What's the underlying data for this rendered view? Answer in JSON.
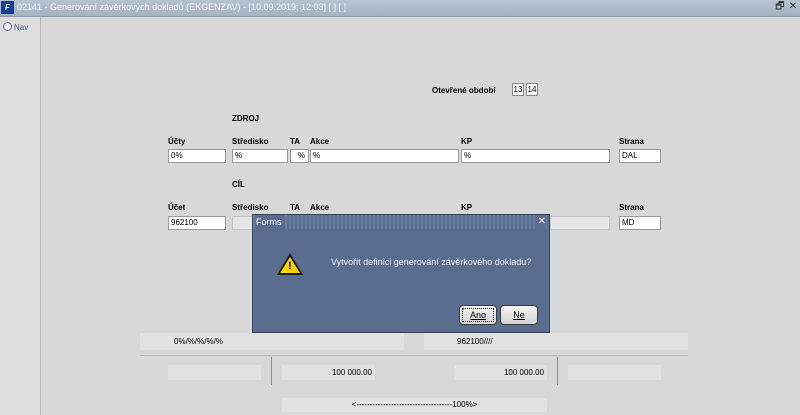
{
  "window": {
    "title": "02141 - Generování závěrkových dokladů (EKGENZAV) - [10.09.2019; 12:03]  [ ]  [ ]",
    "logo_text": "F",
    "restore_glyph": "🗗",
    "close_glyph": "✕"
  },
  "nav": {
    "label": "Nav"
  },
  "obdobi": {
    "label": "Otevřené období",
    "values": [
      "13",
      "14"
    ]
  },
  "zdroj": {
    "heading": "ZDROJ",
    "labels": {
      "ucty": "Účty",
      "stredisko": "Středisko",
      "ta": "TA",
      "akce": "Akce",
      "kp": "KP",
      "strana": "Strana"
    },
    "values": {
      "ucty": "0%",
      "stredisko": "%",
      "ta": "%",
      "akce": "%",
      "kp": "%",
      "strana": "DAL"
    }
  },
  "cil": {
    "heading": "CÍL",
    "labels": {
      "ucet": "Účet",
      "stredisko": "Středisko",
      "ta": "TA",
      "akce": "Akce",
      "kp": "KP",
      "strana": "Strana"
    },
    "values": {
      "ucet": "962100",
      "strana": "MD"
    }
  },
  "summary": {
    "left_code": "0%/%/%/%/%",
    "right_code": "962100////",
    "left_amount": "100 000.00",
    "right_amount": "100 000.00",
    "progress_text": "<------------------------------------100%>"
  },
  "dialog": {
    "title": "Forms",
    "close_glyph": "✕",
    "message": "Vytvořit definici generování závěrkového dokladu?",
    "warning_mark": "!",
    "yes_label": "Ano",
    "no_label": "Ne"
  }
}
